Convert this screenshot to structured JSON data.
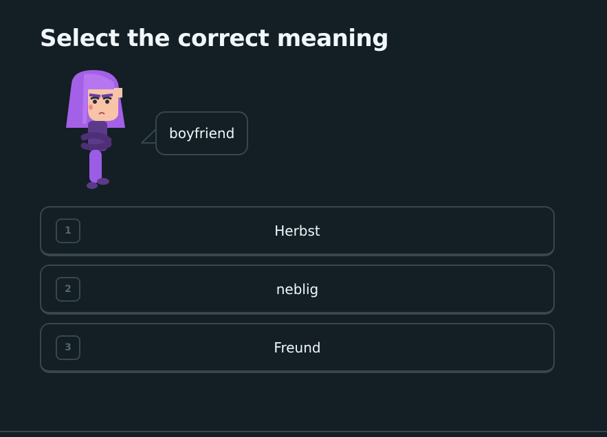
{
  "prompt": {
    "title": "Select the correct meaning",
    "word": "boyfriend"
  },
  "options": [
    {
      "number": "1",
      "label": "Herbst"
    },
    {
      "number": "2",
      "label": "neblig"
    },
    {
      "number": "3",
      "label": "Freund"
    }
  ],
  "colors": {
    "background": "#131f24",
    "border": "#37464f",
    "text": "#f1f7fb",
    "number_text": "#52656d",
    "character_hair": "#a560e8",
    "character_body": "#9b5de5",
    "character_skin": "#f7c4a8"
  }
}
